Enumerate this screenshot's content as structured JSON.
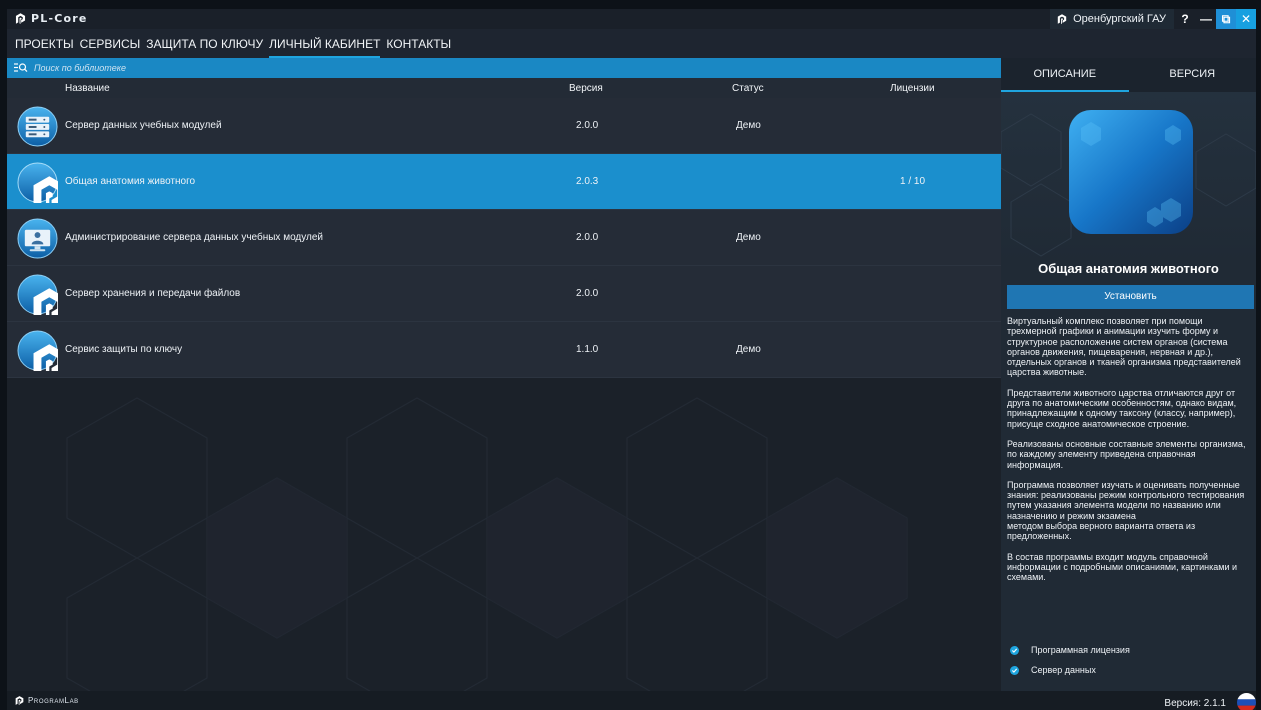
{
  "app": {
    "name": "PL-Core",
    "org": "Оренбургский ГАУ",
    "help_label": "?",
    "minimize_label": "—",
    "maximize_label": "⧉",
    "close_label": "✕"
  },
  "nav": {
    "items": [
      {
        "label": "ПРОЕКТЫ"
      },
      {
        "label": "СЕРВИСЫ"
      },
      {
        "label": "ЗАЩИТА ПО КЛЮЧУ"
      },
      {
        "label": "ЛИЧНЫЙ КАБИНЕТ"
      },
      {
        "label": "КОНТАКТЫ"
      }
    ],
    "active": "ЛИЧНЫЙ КАБИНЕТ"
  },
  "search": {
    "placeholder": "Поиск по библиотеке",
    "icon": "search-list-icon"
  },
  "table": {
    "headers": {
      "name": "Название",
      "version": "Версия",
      "status": "Статус",
      "licenses": "Лицензии"
    },
    "rows": [
      {
        "name": "Сервер данных учебных модулей",
        "version": "2.0.0",
        "status": "Демо",
        "licenses": "",
        "icon": "server-icon"
      },
      {
        "name": "Общая анатомия животного",
        "version": "2.0.3",
        "status": "",
        "licenses": "1 / 10",
        "icon": "pl-logo-icon",
        "selected": true
      },
      {
        "name": "Администрирование сервера данных учебных модулей",
        "version": "2.0.0",
        "status": "Демо",
        "licenses": "",
        "icon": "admin-server-icon"
      },
      {
        "name": "Сервер хранения и передачи файлов",
        "version": "2.0.0",
        "status": "",
        "licenses": "",
        "icon": "pl-logo-icon"
      },
      {
        "name": "Сервис защиты по ключу",
        "version": "1.1.0",
        "status": "Демо",
        "licenses": "",
        "icon": "pl-logo-icon"
      }
    ]
  },
  "details": {
    "tabs": [
      {
        "label": "ОПИСАНИЕ"
      },
      {
        "label": "ВЕРСИЯ"
      }
    ],
    "active_tab": "ОПИСАНИЕ",
    "title": "Общая анатомия животного",
    "install_label": "Установить",
    "description": [
      "Виртуальный комплекс позволяет при помощи трехмерной графики и анимации изучить форму и структурное расположение систем органов (система органов движения, пищеварения, нервная и др.), отдельных органов и тканей организма представителей царства животные.",
      "Представители животного царства отличаются друг от друга по анатомическим особенностям, однако видам, принадлежащим к одному таксону (классу, например), присуще сходное анатомическое строение.",
      "Реализованы основные составные элементы организма, по каждому элементу приведена справочная информация.",
      "Программа позволяет изучать и оценивать полученные знания: реализованы режим контрольного тестирования путем указания элемента модели по названию или назначению и режим экзамена\nметодом выбора верного варианта ответа из предложенных.",
      "В состав программы входит модуль справочной информации с подробными описаниями, картинками и схемами."
    ],
    "features": [
      {
        "label": "Программная лицензия",
        "checked": true
      },
      {
        "label": "Сервер данных",
        "checked": true
      }
    ]
  },
  "footer": {
    "brand": "ProgramLab",
    "version_text": "Версия: 2.1.1",
    "flag_icon": "russia-flag-icon"
  },
  "colors": {
    "accent": "#1fa5df",
    "selected_row": "#1b8fcd",
    "panel": "#252c37",
    "install_button": "#1f76b3"
  }
}
